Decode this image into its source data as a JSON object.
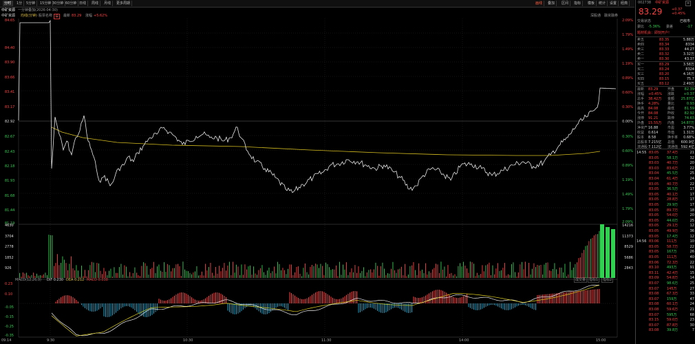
{
  "toolbar": {
    "left": [
      "分时",
      "1分",
      "5分钟",
      "15分钟",
      "30分钟",
      "60分钟",
      "日线",
      "周线",
      "月线",
      "更多周期"
    ],
    "right": [
      "画线",
      "叠加",
      "区间",
      "指标",
      "模板",
      "统计",
      "设置",
      "经典"
    ]
  },
  "info": {
    "stock_tag": "中矿资源",
    "date_range": "一分钟叠加(2026-04-30)",
    "price_label": "最新",
    "price_value": "83.29",
    "pct_label": "涨幅",
    "pct_value": "+5.62%",
    "legend_left": "中矿资源",
    "legend_mid": "均线(分钟)",
    "legend_right": "股票名称",
    "right_btns": [
      "深股通",
      "融资融券"
    ]
  },
  "price_axis": {
    "left": [
      "84.65",
      "84.40",
      "83.90",
      "83.66",
      "83.41",
      "83.17",
      "82.92",
      "82.67",
      "82.43",
      "82.18",
      "81.93",
      "81.68",
      "81.44",
      "81.19"
    ],
    "right": [
      "2.09%",
      "1.79%",
      "1.49%",
      "1.19%",
      "0.89%",
      "0.60%",
      "0.30%",
      "0.00%",
      "0.30%",
      "0.60%",
      "0.89%",
      "1.19%",
      "1.49%",
      "1.79%",
      "2.09%"
    ]
  },
  "volume_axis": {
    "left": [
      "4630",
      "3704",
      "2778",
      "1852",
      "926"
    ],
    "right": [
      "14216",
      "11373",
      "8529",
      "5686",
      "2843"
    ]
  },
  "macd": {
    "label": "MACD(12,26,9)",
    "dif": "DIF 0.230",
    "dea": "DEA 0.212",
    "macd": "MACD 0.038",
    "axis": [
      "0.23",
      "0.10",
      "-0.05",
      "-0.15",
      "-0.25",
      "-0.35"
    ],
    "btns": [
      "成交量",
      "指标1",
      "指标2"
    ]
  },
  "time_axis": [
    "09:14",
    "9:30",
    "10:30",
    "11:30",
    "14:00",
    "15:00"
  ],
  "quote": {
    "code": "002738",
    "name": "中矿资源",
    "price": "83.29",
    "change": "+0.37",
    "change_pct": "+0.45%",
    "status_label": "交易状态",
    "status_value": "已收市",
    "wei_bi_label": "委比",
    "wei_bi": "-5.36%",
    "wei_cha_label": "委差",
    "wei_cha": "-17",
    "news": "题材机会：即刻开户!",
    "asks": [
      {
        "label": "卖五",
        "price": "83.35",
        "vol": "5.88万"
      },
      {
        "label": "卖四",
        "price": "83.34",
        "vol": "8334"
      },
      {
        "label": "卖三",
        "price": "83.33",
        "vol": "44.27"
      },
      {
        "label": "卖二",
        "price": "83.32",
        "vol": "3.32万"
      },
      {
        "label": "卖一",
        "price": "83.30",
        "vol": "43.37"
      }
    ],
    "bids": [
      {
        "label": "买一",
        "price": "83.29",
        "vol": "3.58万"
      },
      {
        "label": "买二",
        "price": "83.24",
        "vol": "8324"
      },
      {
        "label": "买三",
        "price": "83.20",
        "vol": "4.16万"
      },
      {
        "label": "买四",
        "price": "83.15",
        "vol": "75.7"
      },
      {
        "label": "买五",
        "price": "83.12",
        "vol": "2.49万"
      }
    ],
    "stats": [
      {
        "a": "最新",
        "av": "83.29",
        "b": "开盘",
        "bv": "82.39"
      },
      {
        "a": "涨幅",
        "av": "+0.45%",
        "b": "涨跌",
        "bv": "+0.37"
      },
      {
        "a": "总手",
        "av": "38.42万",
        "b": "金额",
        "bv": "25.87亿"
      },
      {
        "a": "换手",
        "av": "4.28%",
        "b": "量比",
        "bv": "0.93"
      },
      {
        "a": "最高",
        "av": "84.08",
        "b": "最低",
        "bv": "81.59"
      },
      {
        "a": "今开",
        "av": "84.08",
        "b": "昨收",
        "bv": "82.92"
      },
      {
        "a": "涨停",
        "av": "91.21",
        "b": "跌停",
        "bv": "74.63"
      },
      {
        "a": "外盘",
        "av": "15.55万",
        "b": "内盘",
        "bv": "14.87万"
      },
      {
        "a": "净资产",
        "av": "16.88",
        "b": "市盈",
        "bv": "3.77%"
      },
      {
        "a": "收益",
        "av": "0.614",
        "b": "市值",
        "bv": "1.31万"
      },
      {
        "a": "股本",
        "av": "8.58",
        "b": "换手率",
        "bv": "0.68%"
      },
      {
        "a": "总股本",
        "av": "7.215亿",
        "b": "总值",
        "bv": "600.9亿"
      },
      {
        "a": "流通股",
        "av": "7.112亿",
        "b": "流通值",
        "bv": "592.4亿"
      }
    ],
    "trades": [
      {
        "t": "14:55",
        "p": "83.05",
        "v": "37.4万",
        "n": "21"
      },
      {
        "t": "",
        "p": "83.05",
        "v": "58.1万",
        "n": "32"
      },
      {
        "t": "",
        "p": "83.03",
        "v": "40.7万",
        "n": "20"
      },
      {
        "t": "",
        "p": "83.03",
        "v": "83.6万",
        "n": "22"
      },
      {
        "t": "",
        "p": "83.04",
        "v": "45.5万",
        "n": "25"
      },
      {
        "t": "",
        "p": "83.04",
        "v": "61.4万",
        "n": "24"
      },
      {
        "t": "",
        "p": "83.05",
        "v": "40.7万",
        "n": "22"
      },
      {
        "t": "",
        "p": "83.05",
        "v": "36.5万",
        "n": "17"
      },
      {
        "t": "",
        "p": "83.05",
        "v": "40.1万",
        "n": "17"
      },
      {
        "t": "",
        "p": "83.05",
        "v": "28.8万",
        "n": "17"
      },
      {
        "t": "",
        "p": "83.05",
        "v": "29.9万",
        "n": "17"
      },
      {
        "t": "",
        "p": "83.05",
        "v": "89.7万",
        "n": "18"
      },
      {
        "t": "",
        "p": "83.05",
        "v": "54.0万",
        "n": "20"
      },
      {
        "t": "",
        "p": "83.05",
        "v": "44.0万",
        "n": "25"
      },
      {
        "t": "",
        "p": "83.05",
        "v": "29.1万",
        "n": "12"
      },
      {
        "t": "",
        "p": "83.05",
        "v": "49.9万",
        "n": "36"
      },
      {
        "t": "",
        "p": "83.05",
        "v": "17.4万",
        "n": "12"
      },
      {
        "t": "14:56",
        "p": "83.06",
        "v": "111万",
        "n": "10"
      },
      {
        "t": "",
        "p": "83.05",
        "v": "58.7万",
        "n": "22"
      },
      {
        "t": "",
        "p": "83.05",
        "v": "167万",
        "n": "26"
      },
      {
        "t": "",
        "p": "83.05",
        "v": "111万",
        "n": "40"
      },
      {
        "t": "",
        "p": "83.06",
        "v": "72.3万",
        "n": "22"
      },
      {
        "t": "",
        "p": "83.10",
        "v": "493万",
        "n": "91"
      },
      {
        "t": "",
        "p": "83.11",
        "v": "42.4万",
        "n": "15"
      },
      {
        "t": "",
        "p": "83.09",
        "v": "54.8万",
        "n": "14"
      },
      {
        "t": "",
        "p": "83.07",
        "v": "98.6万",
        "n": "25"
      },
      {
        "t": "",
        "p": "83.07",
        "v": "145万",
        "n": "27"
      },
      {
        "t": "",
        "p": "83.08",
        "v": "67.3万",
        "n": "33"
      },
      {
        "t": "",
        "p": "83.07",
        "v": "159万",
        "n": "47"
      },
      {
        "t": "",
        "p": "83.08",
        "v": "60.1万",
        "n": "24"
      },
      {
        "t": "",
        "p": "83.08",
        "v": "59.6万",
        "n": "21"
      },
      {
        "t": "",
        "p": "83.07",
        "v": "595万",
        "n": "68"
      },
      {
        "t": "",
        "p": "83.15",
        "v": "59.0万",
        "n": "23"
      },
      {
        "t": "",
        "p": "83.07",
        "v": "87.8万",
        "n": "30"
      },
      {
        "t": "",
        "p": "83.08",
        "v": "39.8万",
        "n": "7"
      }
    ]
  },
  "colors": {
    "up": "#ff4040",
    "down": "#30d050",
    "price_line": "#e8e8e8",
    "avg_line": "#d8c020",
    "dif": "#f0f0f0",
    "dea": "#e0d020"
  }
}
